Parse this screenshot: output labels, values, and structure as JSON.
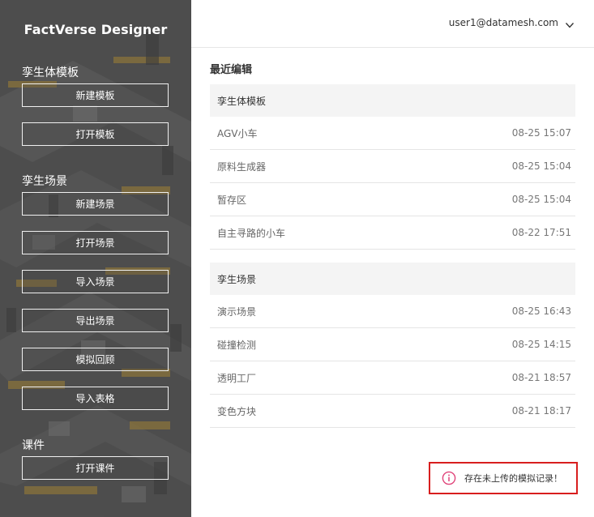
{
  "app": {
    "title": "FactVerse Designer"
  },
  "sidebar": {
    "sections": [
      {
        "title": "孪生体模板",
        "buttons": [
          "新建模板",
          "打开模板"
        ]
      },
      {
        "title": "孪生场景",
        "buttons": [
          "新建场景",
          "打开场景",
          "导入场景",
          "导出场景",
          "模拟回顾",
          "导入表格"
        ]
      },
      {
        "title": "课件",
        "buttons": [
          "打开课件"
        ]
      }
    ]
  },
  "header": {
    "user_email": "user1@datamesh.com",
    "menu_icon": "chevron-down-icon"
  },
  "main": {
    "title": "最近编辑",
    "groups": [
      {
        "name": "孪生体模板",
        "items": [
          {
            "name": "AGV小车",
            "time": "08-25 15:07"
          },
          {
            "name": "原料生成器",
            "time": "08-25 15:04"
          },
          {
            "name": "暂存区",
            "time": "08-25 15:04"
          },
          {
            "name": "自主寻路的小车",
            "time": "08-22 17:51"
          }
        ]
      },
      {
        "name": "孪生场景",
        "items": [
          {
            "name": "演示场景",
            "time": "08-25 16:43"
          },
          {
            "name": "碰撞检测",
            "time": "08-25 14:15"
          },
          {
            "name": "透明工厂",
            "time": "08-21 18:57"
          },
          {
            "name": "变色方块",
            "time": "08-21 18:17"
          }
        ]
      }
    ]
  },
  "warning": {
    "text": "存在未上传的模拟记录！",
    "icon": "info-circle-icon"
  },
  "colors": {
    "sidebar_bg": "#5c5c5c",
    "accent_yellow": "#e0b23a",
    "warning_border": "#d81e1e",
    "warning_icon": "#e0447a"
  }
}
